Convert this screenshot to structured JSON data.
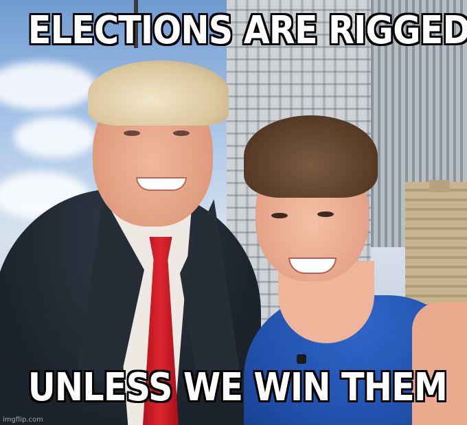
{
  "meme": {
    "top_text": "ELECTIONS ARE RIGGED",
    "bottom_text": "UNLESS WE WIN THEM",
    "watermark": "imgflip.com"
  },
  "colors": {
    "caption_fill": "#ffffff",
    "caption_outline": "#000000",
    "tie": "#e02530",
    "dress": "#2f67c9",
    "suit": "#1c222a"
  }
}
